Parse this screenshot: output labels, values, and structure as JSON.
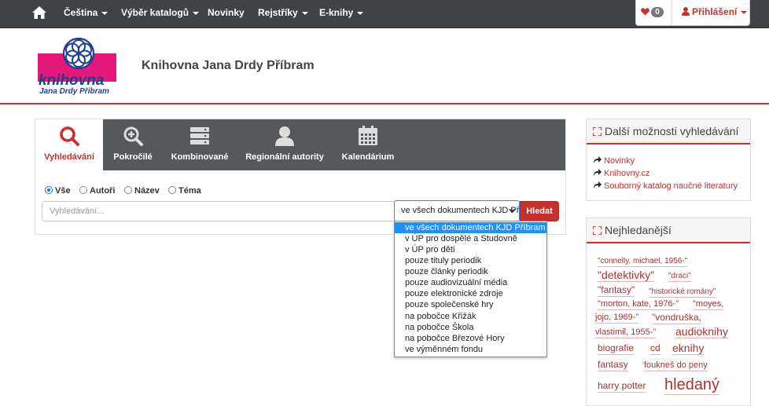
{
  "nav": {
    "language": "Čeština",
    "catalog": "Výběr katalogů",
    "news": "Novinky",
    "registers": "Rejstříky",
    "ebooks": "E-knihy",
    "favorites_count": "0",
    "login": "Přihlášení"
  },
  "header": {
    "logo_text": "knihovna",
    "logo_subtext": "Jana Drdy Příbram",
    "title": "Knihovna Jana Drdy Příbram"
  },
  "tabs": [
    {
      "label": "Vyhledávání",
      "icon": "search-icon"
    },
    {
      "label": "Pokročilé",
      "icon": "zoom-in-icon"
    },
    {
      "label": "Kombinované",
      "icon": "server-icon"
    },
    {
      "label": "Regionální autority",
      "icon": "user-icon"
    },
    {
      "label": "Kalendárium",
      "icon": "calendar-icon"
    }
  ],
  "radios": [
    {
      "label": "Vše",
      "checked": true
    },
    {
      "label": "Autoři",
      "checked": false
    },
    {
      "label": "Název",
      "checked": false
    },
    {
      "label": "Téma",
      "checked": false
    }
  ],
  "search": {
    "placeholder": "Vyhledávání...",
    "scope_selected": "ve všech dokumentech KJD Příbram",
    "button": "Hledat"
  },
  "scope_options": [
    "ve všech dokumentech KJD Příbram",
    "v ÚP pro dospělé a Studovně",
    "v ÚP pro děti",
    "pouze tituly periodik",
    "pouze články periodik",
    "pouze audiovizuální média",
    "pouze elektronické zdroje",
    "pouze společenské hry",
    "na pobočce Křižák",
    "na pobočce Škola",
    "na pobočce Březové Hory",
    "ve výměnném fondu"
  ],
  "sidebar": {
    "more_title": "Další možnosti vyhledávání",
    "links": [
      "Novinky",
      "Knihovny.cz",
      "Souborný katalog naučné literatury"
    ],
    "popular_title": "Nejhledanější",
    "tags": [
      "\"connelly, michael, 1956-\"",
      "\"detektivky\"",
      "\"draci\"",
      "\"fantasy\"",
      "\"historické romány\"",
      "\"morton, kate, 1976-\"",
      "\"moyes,",
      "jojo, 1969-\"",
      "\"vondruška,",
      "vlastimil, 1955-\"",
      "audioknihy",
      "biografie",
      "cd",
      "eknihy",
      "fantasy",
      "foukneš do peny",
      "harry potter",
      "hledaný"
    ]
  },
  "colors": {
    "navbar": "#3f4346",
    "accent": "#c9302c",
    "tabbar": "#55595c",
    "selection": "#1e90ff"
  }
}
